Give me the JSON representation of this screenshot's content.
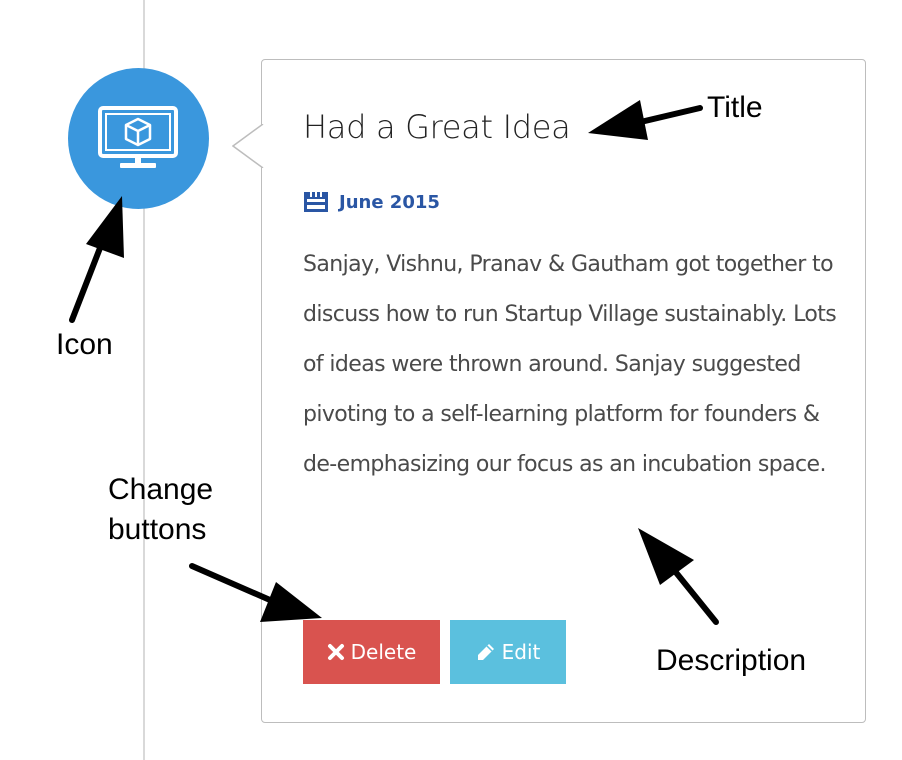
{
  "card": {
    "title": "Had a Great Idea",
    "date": "June 2015",
    "description": "Sanjay, Vishnu, Pranav & Gautham got together to discuss how to run Startup Village sustainably. Lots of ideas were thrown around. Sanjay suggested pivoting to a self-learning platform for founders & de-emphasizing our focus as an incubation space.",
    "delete_label": "Delete",
    "edit_label": "Edit"
  },
  "icons": {
    "timeline_icon": "monitor-cube-icon",
    "date_icon": "calendar-icon",
    "delete_icon": "times-icon",
    "edit_icon": "pencil-icon"
  },
  "annotations": {
    "title": "Title",
    "icon": "Icon",
    "change_buttons_line1": "Change",
    "change_buttons_line2": "buttons",
    "description": "Description"
  },
  "colors": {
    "icon_circle": "#3a97dd",
    "date_text": "#2a56a4",
    "delete_button": "#d9534f",
    "edit_button": "#5bc0de"
  }
}
